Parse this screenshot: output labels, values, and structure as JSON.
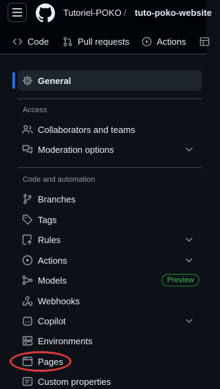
{
  "header": {
    "owner": "Tutoriel-POKO",
    "separator": "/",
    "repo": "tuto-poko-website"
  },
  "tabs": [
    {
      "label": "Code",
      "icon": "code-icon"
    },
    {
      "label": "Pull requests",
      "icon": "git-pull-request-icon"
    },
    {
      "label": "Actions",
      "icon": "play-icon"
    }
  ],
  "sidebar": {
    "general": "General",
    "access_heading": "Access",
    "access_items": [
      {
        "label": "Collaborators and teams",
        "icon": "people-icon"
      },
      {
        "label": "Moderation options",
        "icon": "comment-discussion-icon"
      }
    ],
    "automation_heading": "Code and automation",
    "automation_items": [
      {
        "label": "Branches",
        "icon": "git-branch-icon"
      },
      {
        "label": "Tags",
        "icon": "tag-icon"
      },
      {
        "label": "Rules",
        "icon": "repo-push-icon"
      },
      {
        "label": "Actions",
        "icon": "play-icon"
      },
      {
        "label": "Models",
        "icon": "models-icon"
      },
      {
        "label": "Webhooks",
        "icon": "webhook-icon"
      },
      {
        "label": "Copilot",
        "icon": "copilot-icon"
      },
      {
        "label": "Environments",
        "icon": "server-icon"
      },
      {
        "label": "Pages",
        "icon": "browser-icon"
      },
      {
        "label": "Custom properties",
        "icon": "note-icon"
      }
    ],
    "models_badge": "Preview"
  },
  "colors": {
    "background": "#0d1117",
    "header": "#010409",
    "accent": "#1f6feb",
    "badge": "#3fb950",
    "highlight": "#d93a3a"
  }
}
